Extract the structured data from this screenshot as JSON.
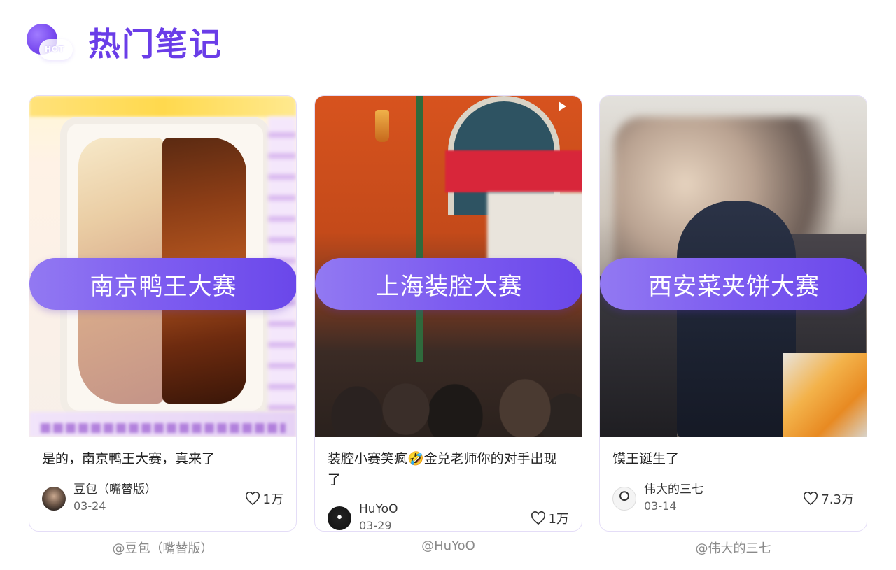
{
  "header": {
    "badge_text": "HOT",
    "title": "热门笔记"
  },
  "cards": [
    {
      "pill_title": "南京鸭王大赛",
      "description": "是的，南京鸭王大赛，真来了",
      "author": "豆包（嘴替版）",
      "date": "03-24",
      "likes": "1万",
      "credit": "@豆包（嘴替版）"
    },
    {
      "pill_title": "上海装腔大赛",
      "description": "装腔小赛笑疯🤣金兑老师你的对手出现了",
      "author": "HuYoO",
      "date": "03-29",
      "likes": "1万",
      "credit": "@HuYoO"
    },
    {
      "pill_title": "西安菜夹饼大赛",
      "description": "馍王诞生了",
      "author": "伟大的三七",
      "date": "03-14",
      "likes": "7.3万",
      "credit": "@伟大的三七"
    }
  ],
  "colors": {
    "accent": "#6a3de8",
    "pill_start": "#9279f2",
    "pill_end": "#6a47ea"
  }
}
